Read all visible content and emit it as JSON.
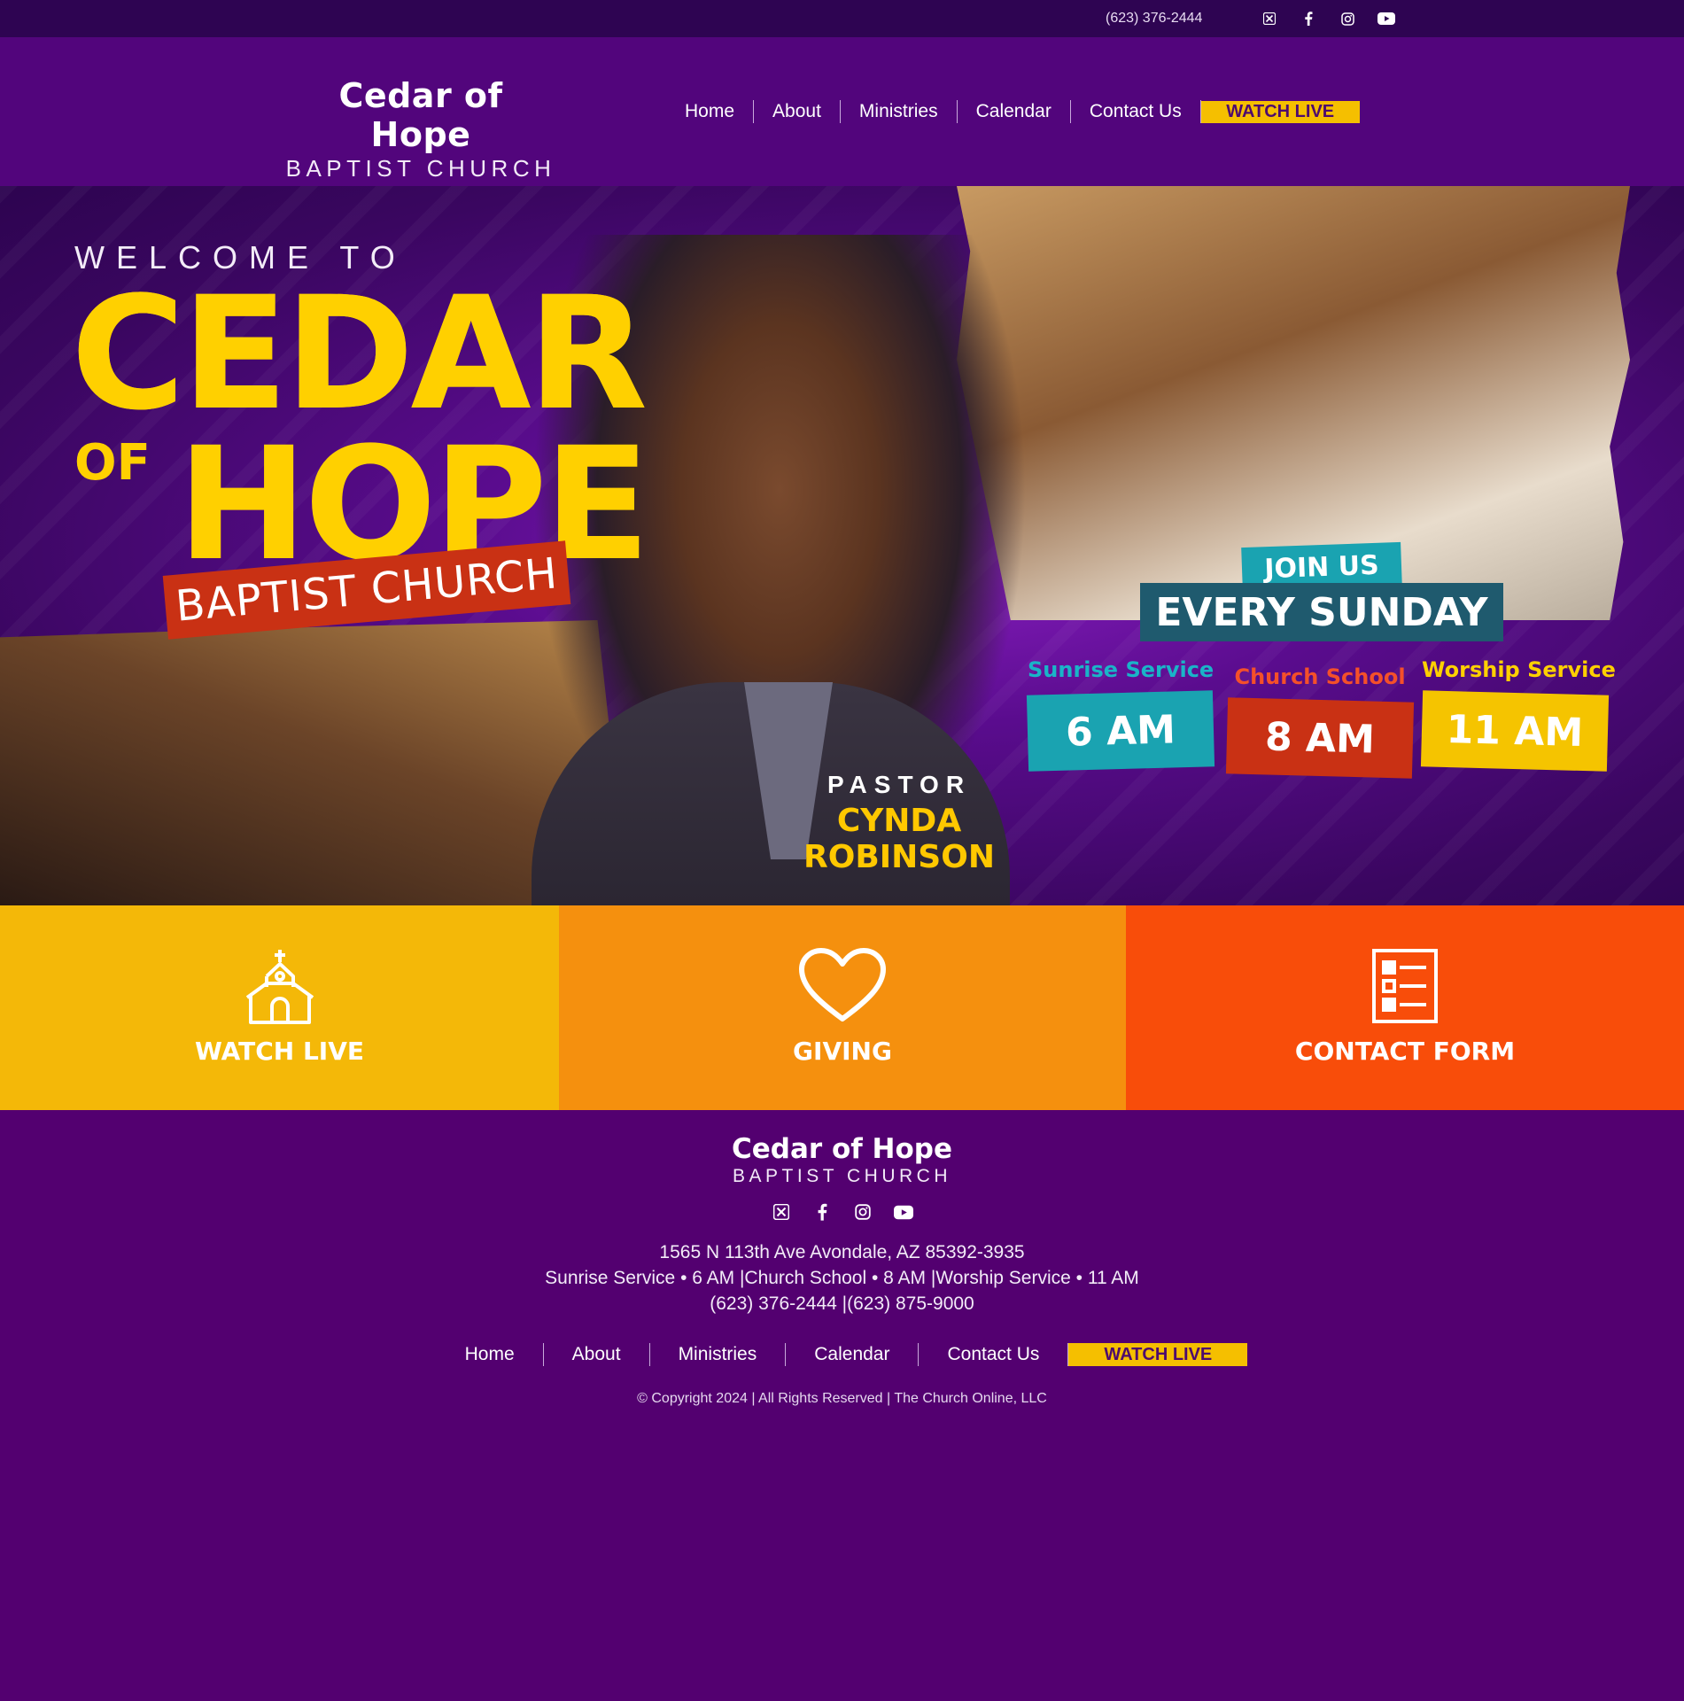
{
  "topbar": {
    "phone": "(623) 376-2444",
    "socials": [
      "x-icon",
      "facebook-icon",
      "instagram-icon",
      "youtube-icon"
    ]
  },
  "header": {
    "logo_line1": "Cedar of Hope",
    "logo_line2": "BAPTIST CHURCH",
    "nav": [
      "Home",
      "About",
      "Ministries",
      "Calendar",
      "Contact Us"
    ],
    "watch_live": "WATCH LIVE"
  },
  "hero": {
    "welcome": "WELCOME TO",
    "cedar": "CEDAR",
    "of": "OF",
    "hope": "HOPE",
    "baptist": "BAPTIST CHURCH",
    "pastor_label": "PASTOR",
    "pastor_name": "CYNDA ROBINSON",
    "join_us": "JOIN US",
    "every_sunday": "EVERY SUNDAY",
    "services": [
      {
        "name": "Sunrise Service",
        "time": "6 AM"
      },
      {
        "name": "Church School",
        "time": "8 AM"
      },
      {
        "name": "Worship Service",
        "time": "11 AM"
      }
    ]
  },
  "cta": [
    {
      "label": "WATCH LIVE",
      "icon": "church-icon"
    },
    {
      "label": "GIVING",
      "icon": "heart-icon"
    },
    {
      "label": "CONTACT FORM",
      "icon": "form-icon"
    }
  ],
  "footer": {
    "logo_line1": "Cedar of Hope",
    "logo_line2": "BAPTIST CHURCH",
    "address": "1565 N 113th Ave Avondale, AZ 85392-3935",
    "services_line": "Sunrise Service • 6 AM |Church School • 8 AM |Worship Service • 11 AM",
    "phones": "(623) 376-2444 |(623) 875-9000",
    "nav": [
      "Home",
      "About",
      "Ministries",
      "Calendar",
      "Contact Us"
    ],
    "watch_live": "WATCH LIVE",
    "copyright": "© Copyright 2024 | All Rights Reserved | The Church Online, LLC"
  },
  "colors": {
    "top_bar": "#2e0452",
    "header_bg": "#52057c",
    "page_bg": "#530070",
    "accent_yellow": "#f5bf00",
    "cta_yellow": "#f4b808",
    "cta_orange": "#f5900e",
    "cta_red_orange": "#f84d0a",
    "teal": "#1aa3b1",
    "red": "#c93114"
  }
}
